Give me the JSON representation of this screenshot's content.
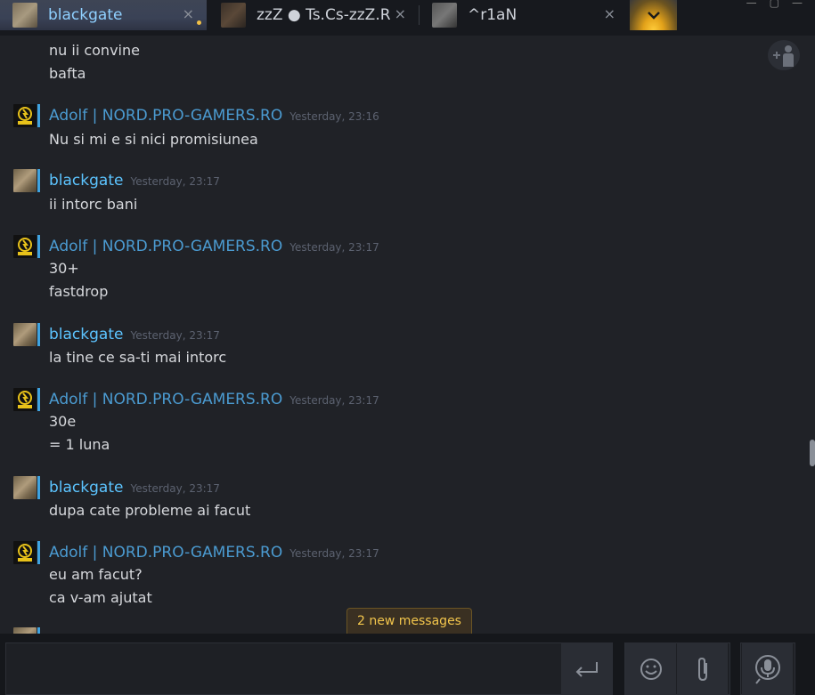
{
  "tabs": [
    {
      "name": "blackgate",
      "close": "×"
    },
    {
      "name": "zzZ ● Ts.Cs-zzZ.Ro",
      "close": "×"
    },
    {
      "name": "^r1aN",
      "close": "×"
    }
  ],
  "overflow_icon": "chevron-down-icon",
  "messages": {
    "m0": {
      "lines": [
        "nu ii convine",
        "bafta"
      ]
    },
    "m1": {
      "author": "Adolf | NORD.PRO-GAMERS.RO",
      "time": "Yesterday, 23:16",
      "lines": [
        "Nu si mi e si nici promisiunea"
      ]
    },
    "m2": {
      "author": "blackgate",
      "time": "Yesterday, 23:17",
      "lines": [
        "ii intorc bani"
      ]
    },
    "m3": {
      "author": "Adolf | NORD.PRO-GAMERS.RO",
      "time": "Yesterday, 23:17",
      "lines": [
        "30+",
        "fastdrop"
      ]
    },
    "m4": {
      "author": "blackgate",
      "time": "Yesterday, 23:17",
      "lines": [
        "la tine ce sa-ti mai intorc"
      ]
    },
    "m5": {
      "author": "Adolf | NORD.PRO-GAMERS.RO",
      "time": "Yesterday, 23:17",
      "lines": [
        "30e",
        "= 1 luna"
      ]
    },
    "m6": {
      "author": "blackgate",
      "time": "Yesterday, 23:17",
      "lines": [
        "dupa cate probleme ai facut"
      ]
    },
    "m7": {
      "author": "Adolf | NORD.PRO-GAMERS.RO",
      "time": "Yesterday, 23:17",
      "lines": [
        "eu am facut?",
        "ca v-am ajutat"
      ]
    }
  },
  "new_messages_label": "2 new messages",
  "composer": {
    "placeholder": ""
  },
  "colors": {
    "self_name": "#5cc4ff",
    "friend_name": "#4b9bd1",
    "online_bar": "#3fa3e0",
    "accent_new": "#f3c64c"
  }
}
